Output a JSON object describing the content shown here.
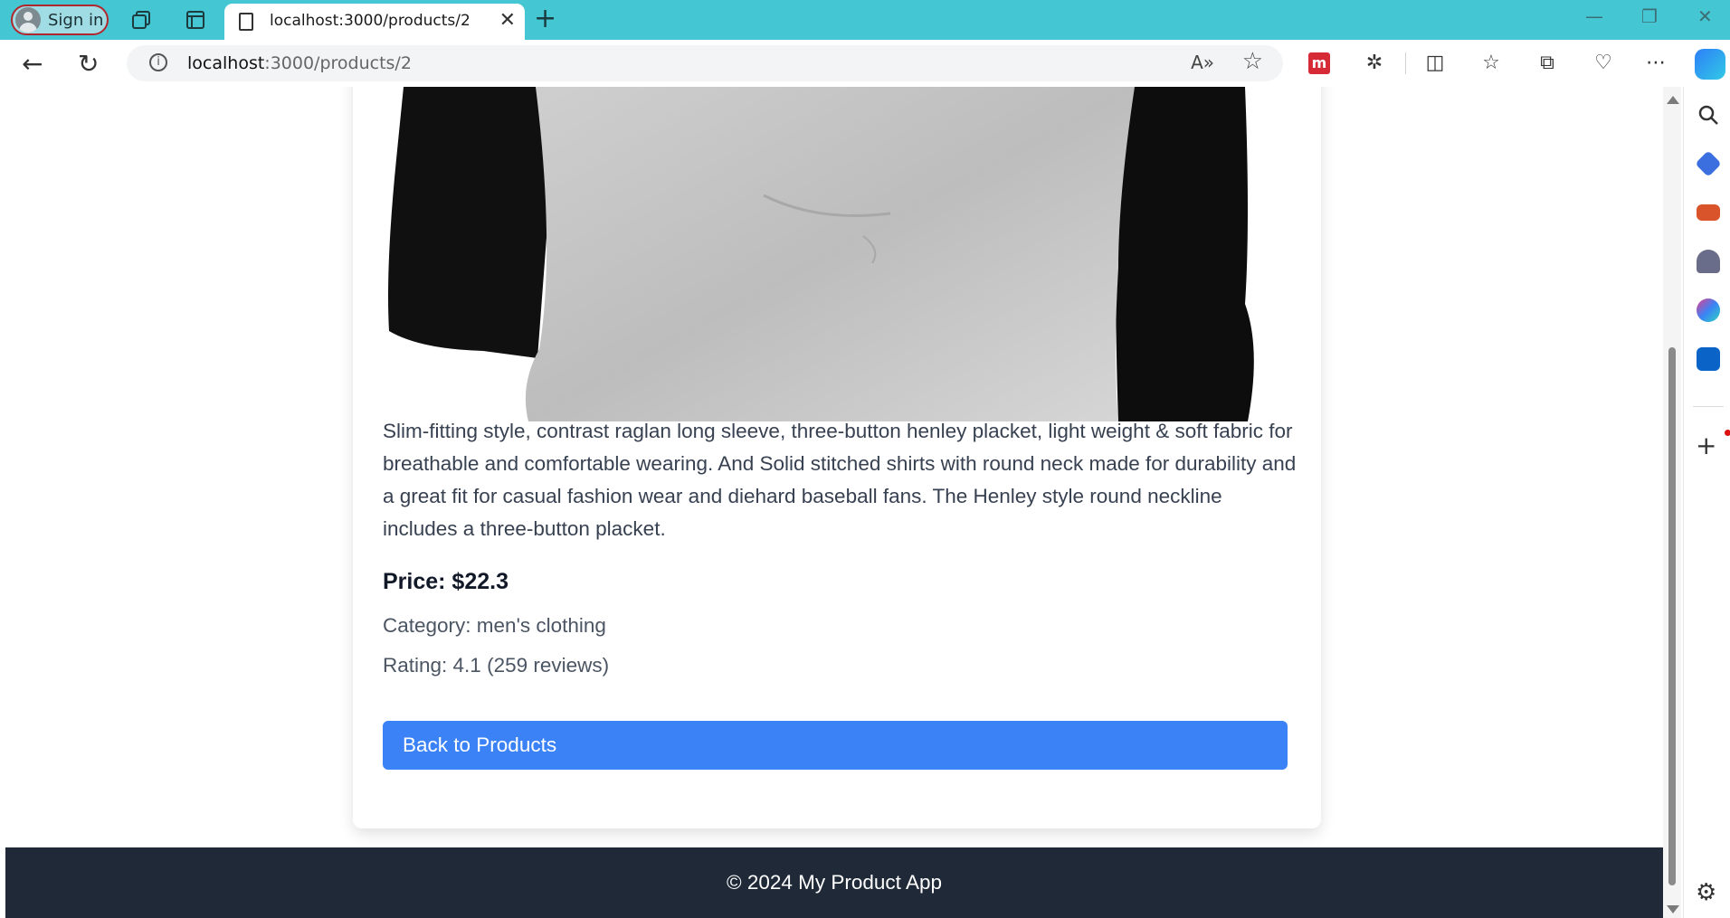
{
  "browser": {
    "profile_label": "Sign in",
    "tab_title": "localhost:3000/products/2",
    "url_host": "localhost",
    "url_path": ":3000/products/2",
    "window_controls": [
      "minimize",
      "restore",
      "close"
    ],
    "toolbar_icons": [
      "read-aloud-icon",
      "favorite-star-icon",
      "extension-red-icon",
      "extensions-puzzle-icon",
      "split-screen-icon",
      "favorites-icon",
      "collections-icon",
      "browser-essentials-icon",
      "more-menu-icon",
      "copilot-icon"
    ],
    "sidebar_icons": [
      "search-icon",
      "shopping-tag-icon",
      "toolbox-icon",
      "games-icon",
      "microsoft365-icon",
      "outlook-icon",
      "add-icon",
      "settings-icon"
    ]
  },
  "product": {
    "image_alt": "Raglan long sleeve henley shirt",
    "description": "Slim-fitting style, contrast raglan long sleeve, three-button henley placket, light weight & soft fabric for breathable and comfortable wearing. And Solid stitched shirts with round neck made for durability and a great fit for casual fashion wear and diehard baseball fans. The Henley style round neckline includes a three-button placket.",
    "price_label": "Price: $22.3",
    "category_label": "Category: men's clothing",
    "rating_label": "Rating: 4.1 (259 reviews)",
    "back_button_label": "Back to Products"
  },
  "footer": {
    "text": "© 2024 My Product App"
  },
  "colors": {
    "tabbar": "#45c6d3",
    "button": "#3b82f6",
    "footer": "#1f2937"
  }
}
